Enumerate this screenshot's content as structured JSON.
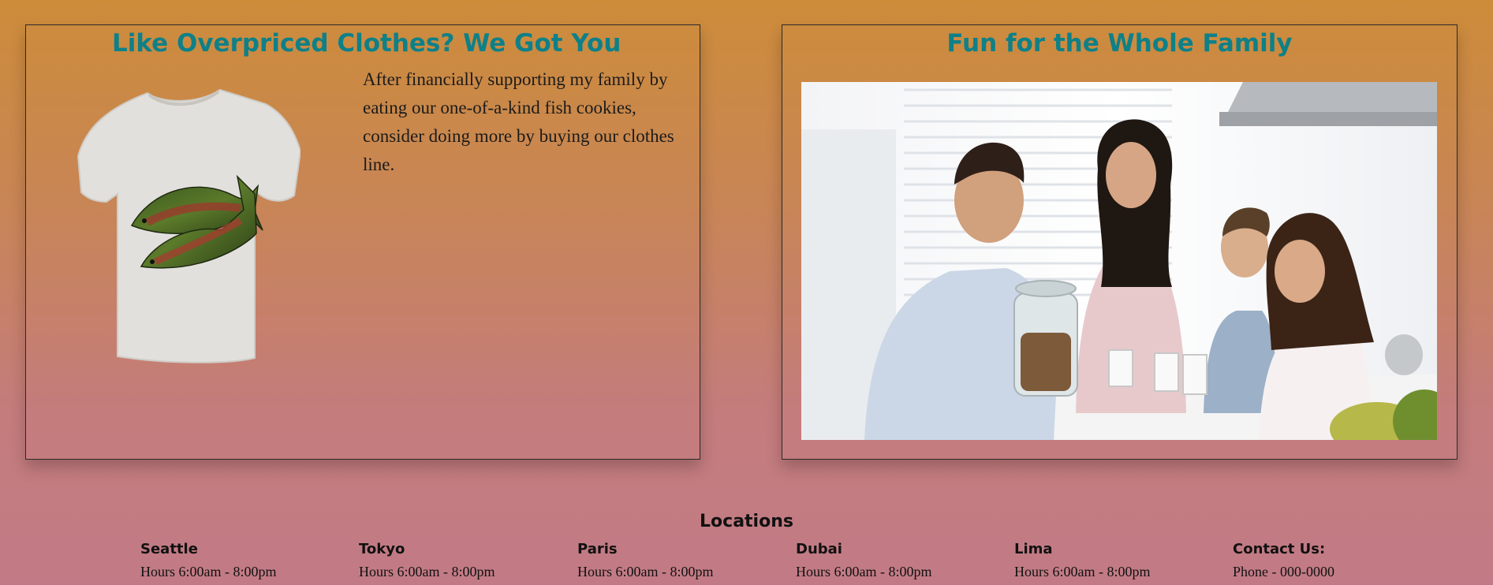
{
  "clothes_section": {
    "title": "Like Overpriced Clothes? We Got You",
    "description": "After financially supporting my family by eating our one-of-a-kind fish cookies, consider doing more by buying our clothes line."
  },
  "family_section": {
    "title": "Fun for the Whole Family"
  },
  "locations": {
    "heading": "Locations",
    "items": [
      {
        "name": "Seattle",
        "info": "Hours 6:00am - 8:00pm"
      },
      {
        "name": "Tokyo",
        "info": "Hours 6:00am - 8:00pm"
      },
      {
        "name": "Paris",
        "info": "Hours 6:00am - 8:00pm"
      },
      {
        "name": "Dubai",
        "info": "Hours 6:00am - 8:00pm"
      },
      {
        "name": "Lima",
        "info": "Hours 6:00am - 8:00pm"
      },
      {
        "name": "Contact Us:",
        "info": "Phone - 000-0000"
      }
    ]
  },
  "colors": {
    "title_teal": "#0e8088",
    "background_top": "#cd8c3a",
    "background_bottom": "#c27b86"
  }
}
